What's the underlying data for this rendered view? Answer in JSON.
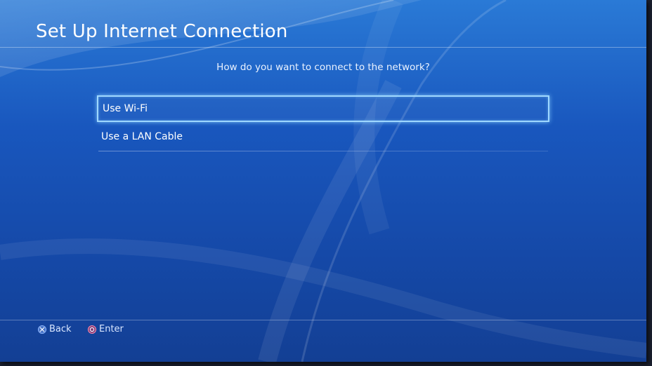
{
  "header": {
    "title": "Set Up Internet Connection"
  },
  "prompt": {
    "question": "How do you want to connect to the network?"
  },
  "options": [
    {
      "label": "Use Wi-Fi",
      "selected": true
    },
    {
      "label": "Use a LAN Cable",
      "selected": false
    }
  ],
  "footer": {
    "back_label": "Back",
    "enter_label": "Enter",
    "back_icon": "cross-button-icon",
    "enter_icon": "circle-button-icon"
  },
  "colors": {
    "background_top": "#2a7ad6",
    "background_bottom": "#133f94",
    "selection_glow": "#9fd8ff",
    "cross_button": "#8fb8ff",
    "circle_button": "#ff8aa8"
  }
}
